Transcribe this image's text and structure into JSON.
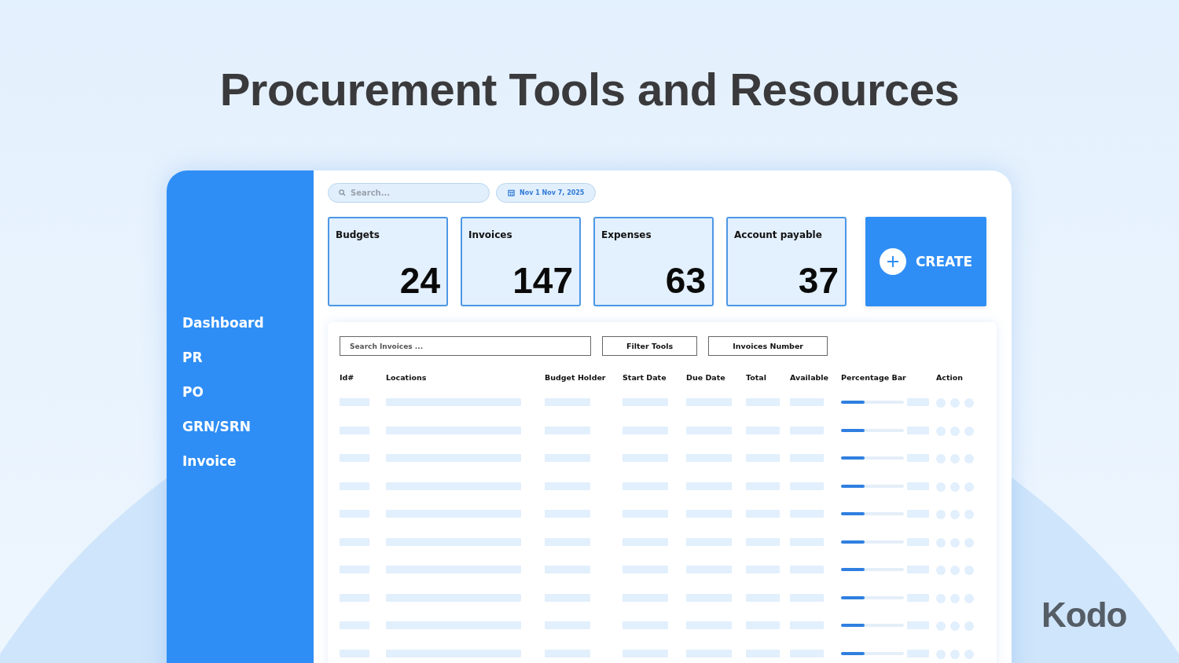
{
  "headline": "Procurement Tools and Resources",
  "sidebar": {
    "items": [
      {
        "label": "Dashboard"
      },
      {
        "label": "PR"
      },
      {
        "label": "PO"
      },
      {
        "label": "GRN/SRN"
      },
      {
        "label": "Invoice"
      }
    ]
  },
  "top_bar": {
    "search": {
      "placeholder": "Search..."
    },
    "date_range": "Nov 1 Nov 7, 2025"
  },
  "stats": [
    {
      "label": "Budgets",
      "value": "24"
    },
    {
      "label": "Invoices",
      "value": "147"
    },
    {
      "label": "Expenses",
      "value": "63"
    },
    {
      "label": "Account payable",
      "value": "37"
    }
  ],
  "create_button": {
    "label": "CREATE"
  },
  "table": {
    "search": {
      "placeholder": "Search Invoices ..."
    },
    "buttons": [
      "Filter Tools",
      "Invoices Number"
    ],
    "columns": [
      "Id#",
      "Locations",
      "Budget Holder",
      "Start Date",
      "Due Date",
      "Total",
      "Available",
      "Percentage Bar",
      "Action"
    ],
    "rows": [
      {
        "level": 0.38
      },
      {
        "level": 0.38
      },
      {
        "level": 0.38
      },
      {
        "level": 0.38
      },
      {
        "level": 0.38
      },
      {
        "level": 0.38
      },
      {
        "level": 0.38
      },
      {
        "level": 0.38
      },
      {
        "level": 0.38
      },
      {
        "level": 0.38
      }
    ]
  },
  "brand": "Kodo"
}
